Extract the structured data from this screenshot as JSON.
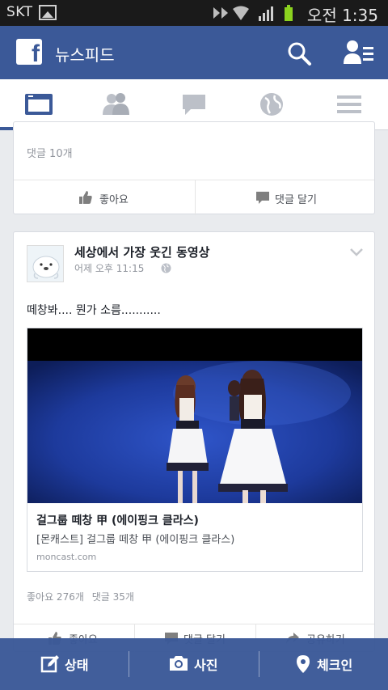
{
  "status_bar": {
    "carrier": "SKT",
    "time": "오전 1:35"
  },
  "header": {
    "title": "뉴스피드",
    "logo_letter": "f"
  },
  "tabs": [
    {
      "icon": "newsfeed-icon",
      "active": true
    },
    {
      "icon": "friend-requests-icon"
    },
    {
      "icon": "messages-icon"
    },
    {
      "icon": "notifications-globe-icon"
    },
    {
      "icon": "menu-icon"
    }
  ],
  "post1": {
    "comment_count": "댓글 10개",
    "like_label": "좋아요",
    "comment_label": "댓글 달기"
  },
  "post2": {
    "page_name": "세상에서 가장 웃긴 동영상",
    "timestamp": "어제 오후 11:15",
    "text": "떼창봐.... 뭔가 소름...........",
    "link": {
      "title": "걸그룹 떼창 甲 (에이핑크 클라스)",
      "description": "[몬캐스트] 걸그룹 떼창 甲 (에이핑크 클라스)",
      "domain": "moncast.com"
    },
    "likes": "좋아요 276개",
    "comments": "댓글 35개",
    "actions": {
      "like": "좋아요",
      "comment": "댓글 달기",
      "share": "공유하기"
    }
  },
  "bottom_bar": {
    "status": "상태",
    "photo": "사진",
    "checkin": "체크인"
  },
  "colors": {
    "brand": "#3b5998",
    "background": "#e9ebee"
  }
}
